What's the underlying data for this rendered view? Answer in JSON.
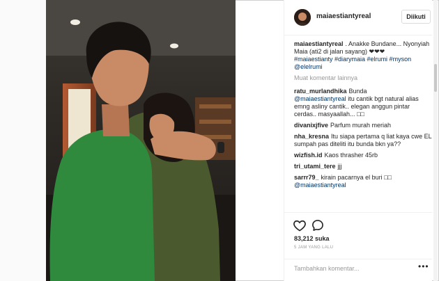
{
  "post": {
    "username": "maiaestiantyreal",
    "follow_label": "Diikuti",
    "caption_user": "maiaestiantyreal",
    "caption_text": ". Anakke Bundane... Nyonyiah Maia (ati2 di jalan sayang) ❤❤❤",
    "caption_tags": "#maiaestianty #diarymaia #elrumi #myson",
    "caption_mention": "@elelrumi",
    "load_more": "Muat komentar lainnya"
  },
  "comments": [
    {
      "user": "ratu_murlandhika",
      "mention": "",
      "text": "Bunda"
    },
    {
      "user": "",
      "mention": "@maiaestiantyreal",
      "text": "itu cantik bgt natural alias emng asliny cantik.. elegan anggun pintar cerdas.. masyaallah... □□"
    },
    {
      "user": "divanixjfive",
      "mention": "",
      "text": "Parfum murah meriah"
    },
    {
      "user": "nha_kresna",
      "mention": "",
      "text": "Itu siapa pertama q liat kaya cwe EL sumpah pas diteliti itu bunda bkn ya??"
    },
    {
      "user": "wizfish.id",
      "mention": "",
      "text": "Kaos thrasher 45rb"
    },
    {
      "user": "tri_utami_tere",
      "mention": "",
      "text": "jjj"
    },
    {
      "user": "sarrr79_",
      "mention": "",
      "text": "kirain pacarnya el buri □□"
    },
    {
      "user": "",
      "mention": "@maiaestiantyreal",
      "text": ""
    }
  ],
  "stats": {
    "likes": "83,212 suka",
    "time": "5 JAM YANG LALU"
  },
  "composer": {
    "placeholder": "Tambahkan komentar...",
    "more_label": "•••"
  },
  "icons": {
    "like": "heart-icon",
    "comment": "comment-bubble-icon"
  }
}
